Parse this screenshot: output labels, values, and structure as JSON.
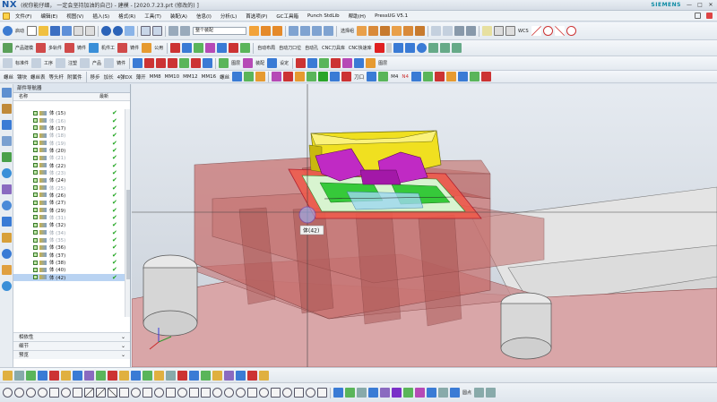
{
  "app": {
    "logo": "NX",
    "title": "(祝你能仔细， 一定会坚持加油的自己)  - 建模 - [2020.7.23.prt  (修改的) ]",
    "brand": "SIEMENS",
    "controls": [
      "—",
      "□",
      "✕"
    ]
  },
  "menu": {
    "items": [
      "文件(F)",
      "编辑(E)",
      "视图(V)",
      "插入(S)",
      "格式(R)",
      "工具(T)",
      "装配(A)",
      "信息(I)",
      "分析(L)",
      "首选项(P)",
      "GC工具箱",
      "Punch StdLib",
      "帮助(H)",
      "PressUG V5.1"
    ]
  },
  "toolbar1": {
    "start_label": "启动",
    "filter_value": "整个装配",
    "snap_label": "选择组",
    "wcs_label": "WCS"
  },
  "toolbar2": {
    "labels": [
      "产品建模",
      "多轨件",
      "铸件",
      "机件工",
      "铸件",
      "公用",
      "自动布局",
      "自动刀口位",
      "自动孔",
      "CNC刀具库",
      "CNC快速库"
    ]
  },
  "toolbar3": {
    "labels": [
      "标准件",
      "工序",
      "注塑",
      "产品",
      "铸件",
      "图层",
      "装配",
      "设定",
      "图层"
    ]
  },
  "toolbar4": {
    "labels": [
      "螺丝",
      "镶块",
      "螺丝表",
      "等头杆",
      "附属件",
      "移步",
      "加长",
      "4弹DX",
      "薄开",
      "MM8",
      "MM10",
      "MM12",
      "MM16",
      "螺丝",
      "刀口",
      "M4",
      "N4"
    ]
  },
  "navigator": {
    "title": "部件导航器",
    "col_name": "名称",
    "col_latest": "最新",
    "rows": [
      {
        "label": "体 (15)",
        "dim": false,
        "sel": false
      },
      {
        "label": "体 (16)",
        "dim": true,
        "sel": false
      },
      {
        "label": "体 (17)",
        "dim": false,
        "sel": false
      },
      {
        "label": "体 (18)",
        "dim": true,
        "sel": false
      },
      {
        "label": "体 (19)",
        "dim": true,
        "sel": false
      },
      {
        "label": "体 (20)",
        "dim": false,
        "sel": false
      },
      {
        "label": "体 (21)",
        "dim": true,
        "sel": false
      },
      {
        "label": "体 (22)",
        "dim": false,
        "sel": false
      },
      {
        "label": "体 (23)",
        "dim": true,
        "sel": false
      },
      {
        "label": "体 (24)",
        "dim": false,
        "sel": false
      },
      {
        "label": "体 (25)",
        "dim": true,
        "sel": false
      },
      {
        "label": "体 (26)",
        "dim": false,
        "sel": false
      },
      {
        "label": "体 (27)",
        "dim": false,
        "sel": false
      },
      {
        "label": "体 (29)",
        "dim": false,
        "sel": false
      },
      {
        "label": "体 (31)",
        "dim": true,
        "sel": false
      },
      {
        "label": "体 (32)",
        "dim": false,
        "sel": false
      },
      {
        "label": "体 (34)",
        "dim": true,
        "sel": false
      },
      {
        "label": "体 (35)",
        "dim": true,
        "sel": false
      },
      {
        "label": "体 (36)",
        "dim": false,
        "sel": false
      },
      {
        "label": "体 (37)",
        "dim": false,
        "sel": false
      },
      {
        "label": "体 (38)",
        "dim": false,
        "sel": false
      },
      {
        "label": "体 (40)",
        "dim": false,
        "sel": false
      },
      {
        "label": "体 (42)",
        "dim": false,
        "sel": true
      }
    ],
    "sections": [
      "相依性",
      "细节",
      "预览"
    ]
  },
  "viewport": {
    "tooltip": "体(42)"
  },
  "bottom": {
    "label": "圆点"
  },
  "colors": {
    "accent": "#1d5aa8",
    "check": "#1aa31a",
    "selection": "#b9d3f2",
    "plate": "#c85a58",
    "insert": "#e8d21a",
    "punch": "#b520b5",
    "cavity": "#3ccf3c"
  }
}
